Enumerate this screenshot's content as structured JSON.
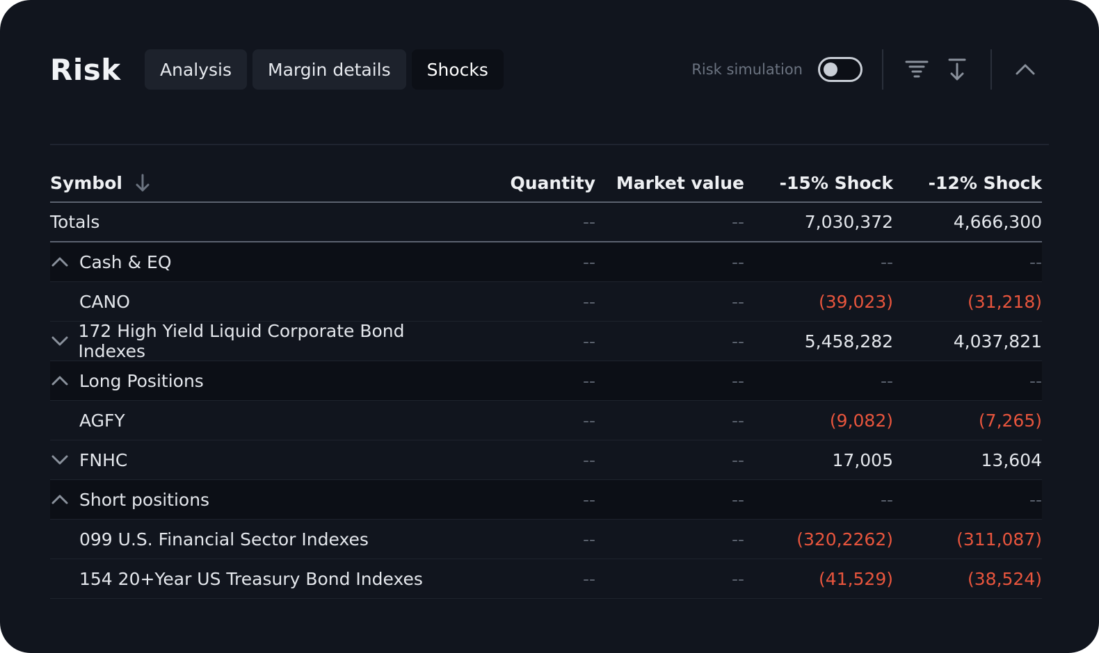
{
  "header": {
    "title": "Risk",
    "tabs": [
      "Analysis",
      "Margin details",
      "Shocks"
    ],
    "active_tab": "Shocks",
    "risk_simulation_label": "Risk simulation",
    "risk_simulation_on": false
  },
  "table": {
    "columns": [
      "Symbol",
      "Quantity",
      "Market value",
      "-15% Shock",
      "-12% Shock"
    ],
    "totals": {
      "label": "Totals",
      "quantity": "--",
      "market_value": "--",
      "shock15": "7,030,372",
      "shock12": "4,666,300"
    },
    "rows": [
      {
        "label": "Cash & EQ",
        "quantity": "--",
        "market_value": "--",
        "shock15": "--",
        "shock12": "--"
      },
      {
        "label": "CANO",
        "quantity": "--",
        "market_value": "--",
        "shock15": "(39,023)",
        "shock12": "(31,218)"
      },
      {
        "label": "172 High Yield Liquid Corporate Bond Indexes",
        "quantity": "--",
        "market_value": "--",
        "shock15": "5,458,282",
        "shock12": "4,037,821"
      },
      {
        "label": "Long Positions",
        "quantity": "--",
        "market_value": "--",
        "shock15": "--",
        "shock12": "--"
      },
      {
        "label": "AGFY",
        "quantity": "--",
        "market_value": "--",
        "shock15": "(9,082)",
        "shock12": "(7,265)"
      },
      {
        "label": "FNHC",
        "quantity": "--",
        "market_value": "--",
        "shock15": "17,005",
        "shock12": "13,604"
      },
      {
        "label": "Short positions",
        "quantity": "--",
        "market_value": "--",
        "shock15": "--",
        "shock12": "--"
      },
      {
        "label": "099 U.S. Financial Sector Indexes",
        "quantity": "--",
        "market_value": "--",
        "shock15": "(320,2262)",
        "shock12": "(311,087)"
      },
      {
        "label": "154 20+Year US Treasury Bond Indexes",
        "quantity": "--",
        "market_value": "--",
        "shock15": "(41,529)",
        "shock12": "(38,524)"
      }
    ]
  },
  "icons": {
    "sort": "arrow-down-icon",
    "filter": "filter-icon",
    "download": "download-icon",
    "collapse": "chevron-up-icon",
    "expanded": "chevron-up-icon",
    "collapsed": "chevron-down-icon"
  },
  "colors": {
    "background": "#11151e",
    "negative": "#e8553d",
    "muted": "#5a616d"
  }
}
